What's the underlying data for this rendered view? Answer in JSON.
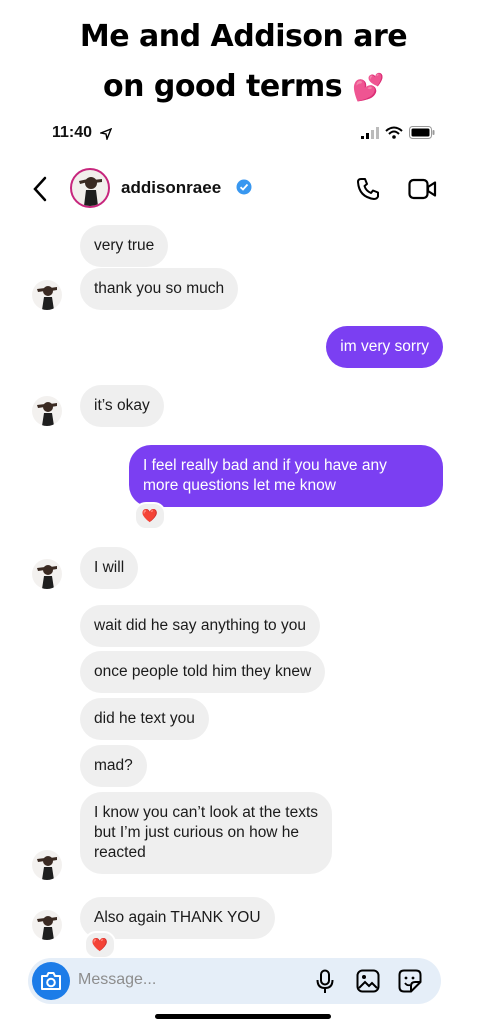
{
  "caption": {
    "line1": "Me and Addison are",
    "line2": "on good terms",
    "emoji": "💕"
  },
  "status_bar": {
    "time": "11:40"
  },
  "header": {
    "username": "addisonraee"
  },
  "messages": [
    {
      "side": "in",
      "text": "very true"
    },
    {
      "side": "in",
      "text": "thank you so much"
    },
    {
      "side": "out",
      "text": "im very sorry"
    },
    {
      "side": "in",
      "text": "it’s okay"
    },
    {
      "side": "out",
      "lines": [
        "I feel really bad and if you have any",
        "more questions let me know"
      ],
      "reaction": "❤️"
    },
    {
      "side": "in",
      "text": "I will"
    },
    {
      "side": "in",
      "text": "wait did he say anything to you"
    },
    {
      "side": "in",
      "text": "once people told him they knew"
    },
    {
      "side": "in",
      "text": "did he text you"
    },
    {
      "side": "in",
      "text": "mad?"
    },
    {
      "side": "in",
      "lines": [
        "I know you can’t look at the texts",
        "but I’m just curious on how he",
        "reacted"
      ]
    },
    {
      "side": "in",
      "text": "Also again THANK YOU",
      "reaction": "❤️"
    }
  ],
  "composer": {
    "placeholder": "Message..."
  },
  "colors": {
    "outgoing": "#7b3ff2",
    "incoming": "#efefef",
    "camera": "#1c7ce8",
    "heart": "#e0245e"
  }
}
